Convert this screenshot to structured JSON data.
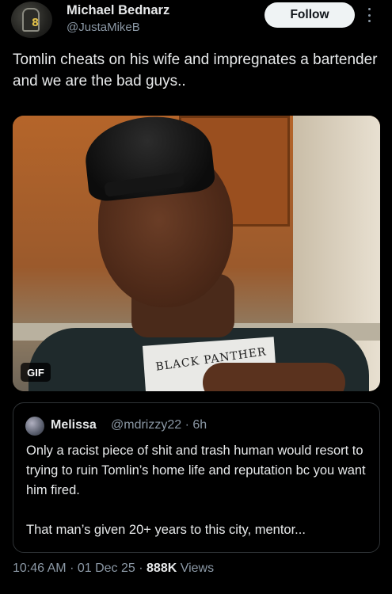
{
  "author": {
    "name": "Michael Bednarz",
    "handle": "@JustaMikeB",
    "avatar_icon": "avatar-football-player",
    "avatar_jersey_number": "8"
  },
  "follow_label": "Follow",
  "more_icon": "vertical-ellipsis-icon",
  "tweet": {
    "text": "Tomlin cheats on his wife and impregnates a bartender and we are the bad guys.."
  },
  "media": {
    "badge": "GIF",
    "shirt_print": "BLACK PANTHER"
  },
  "quote": {
    "name": "Melissa",
    "handle": "@mdrizzy22",
    "separator": "·",
    "time": "6h",
    "paragraph1": "Only a racist piece of shit and trash human would resort to trying to ruin Tomlin’s home life and reputation bc you want him fired.",
    "paragraph2": "That man’s given 20+ years to this city, mentor..."
  },
  "footer": {
    "time": "10:46 AM",
    "sep1": "·",
    "date": "01 Dec 25",
    "sep2": "·",
    "views_count": "888K",
    "views_label": "Views"
  },
  "colors": {
    "background": "#000000",
    "primary_text": "#e7e9ea",
    "secondary_text": "#8b98a5",
    "follow_button_bg": "#eff3f4",
    "border": "#2f3336"
  }
}
